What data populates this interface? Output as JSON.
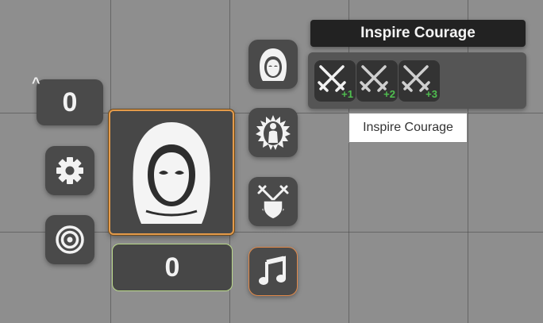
{
  "counter": {
    "value": "0",
    "caret": "^"
  },
  "hp": {
    "value": "0"
  },
  "panel": {
    "title": "Inspire Courage",
    "effects": [
      {
        "label": "+1"
      },
      {
        "label": "+2"
      },
      {
        "label": "+3"
      }
    ]
  },
  "tooltip": {
    "text": "Inspire Courage"
  },
  "colors": {
    "token_border": "#e39a4a",
    "hp_border": "#b9d88a",
    "music_border": "#e38a4a",
    "level_green": "#4fbf4f",
    "panel_title_bg": "#222222"
  },
  "icons": {
    "counter": "chevron-up-icon",
    "settings": "gear-icon",
    "target": "target-icon",
    "token": "hooded-figure-icon",
    "hood": "hood-icon",
    "aura": "aura-figure-icon",
    "combat": "crossed-swords-shield-icon",
    "music": "music-note-icon",
    "effect": "crossed-swords-icon"
  }
}
